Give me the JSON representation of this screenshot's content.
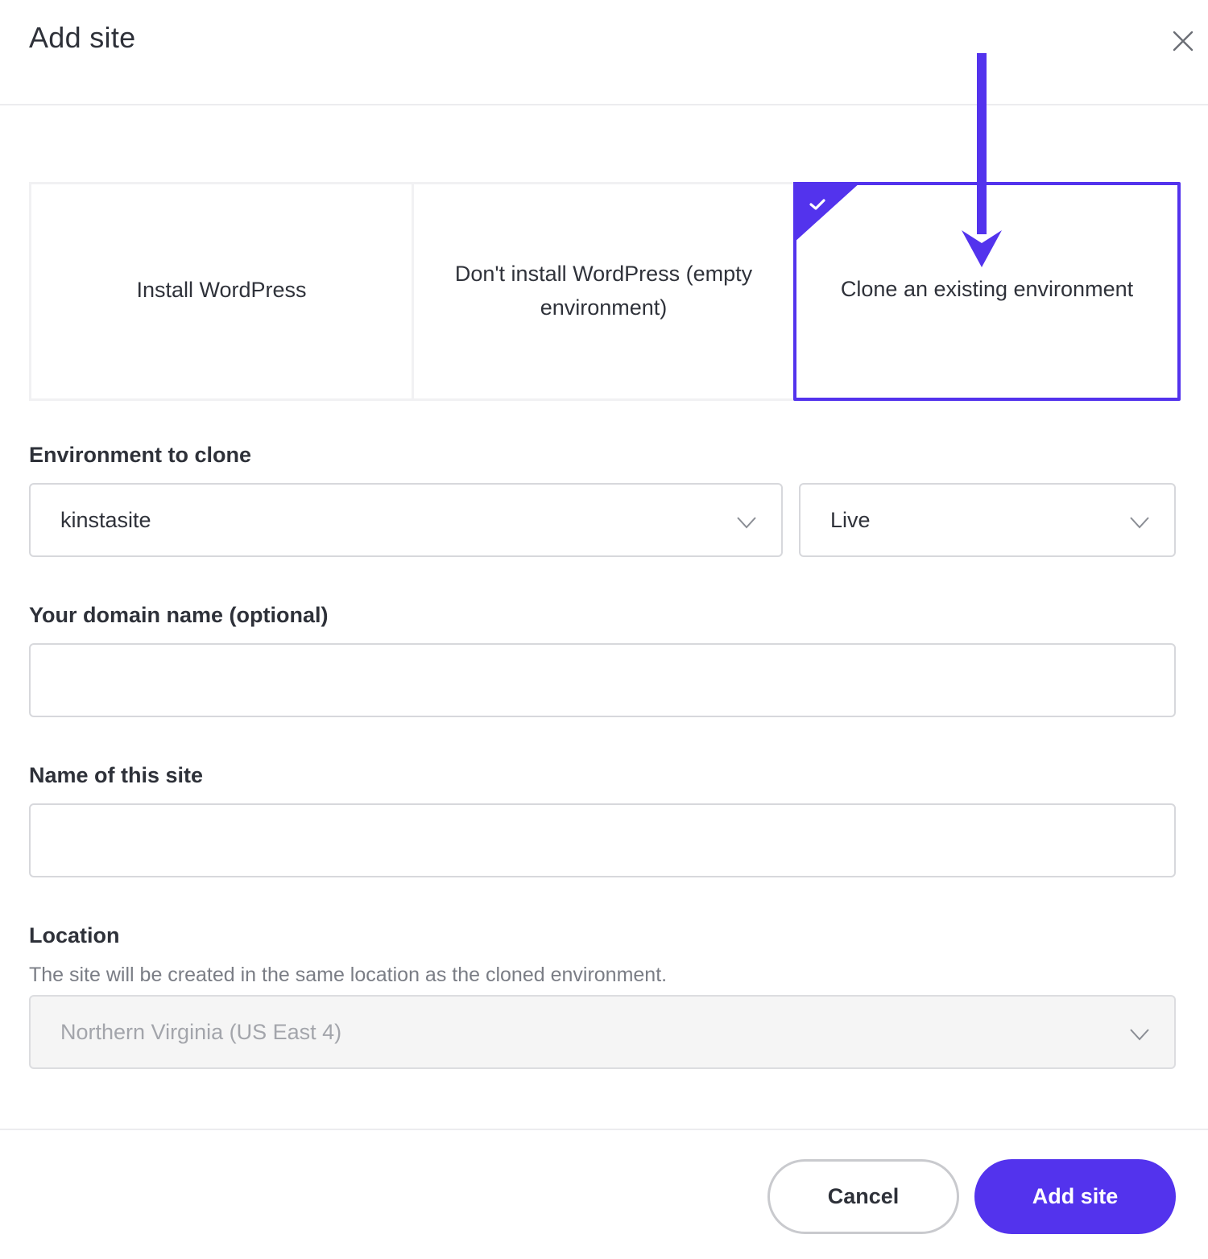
{
  "modal": {
    "title": "Add site"
  },
  "options": [
    {
      "label": "Install WordPress",
      "selected": false
    },
    {
      "label": "Don't install WordPress (empty environment)",
      "selected": false
    },
    {
      "label": "Clone an existing environment",
      "selected": true
    }
  ],
  "env": {
    "label": "Environment to clone",
    "site_value": "kinstasite",
    "env_value": "Live"
  },
  "domain": {
    "label": "Your domain name (optional)",
    "value": "",
    "placeholder": ""
  },
  "site_name": {
    "label": "Name of this site",
    "value": "",
    "placeholder": ""
  },
  "location": {
    "label": "Location",
    "hint": "The site will be created in the same location as the cloned environment.",
    "value": "Northern Virginia (US East 4)",
    "disabled": true
  },
  "footer": {
    "cancel_label": "Cancel",
    "submit_label": "Add site"
  },
  "colors": {
    "accent": "#5333ed",
    "text": "#2e3139",
    "muted": "#7a7d85",
    "border": "#d7d8dc"
  },
  "icons": {
    "close": "close-icon",
    "check": "check-icon",
    "chevron": "chevron-down-icon",
    "arrow": "arrow-down-icon"
  }
}
